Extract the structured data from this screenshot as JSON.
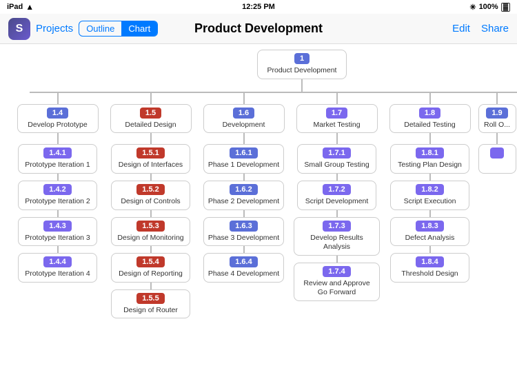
{
  "statusBar": {
    "left": "iPad",
    "time": "12:25 PM",
    "battery": "100%",
    "wifi": true
  },
  "navBar": {
    "projectsLabel": "Projects",
    "outlineLabel": "Outline",
    "chartLabel": "Chart",
    "title": "Product Development",
    "editLabel": "Edit",
    "shareLabel": "Share"
  },
  "root": {
    "id": "1",
    "label": "Product Development",
    "badgeColor": "blue"
  },
  "columns": [
    {
      "id": "1.4",
      "label": "Develop Prototype",
      "badgeColor": "blue",
      "children": [
        {
          "id": "1.4.1",
          "label": "Prototype Iteration 1",
          "badgeColor": "purple"
        },
        {
          "id": "1.4.2",
          "label": "Prototype Iteration 2",
          "badgeColor": "purple"
        },
        {
          "id": "1.4.3",
          "label": "Prototype Iteration 3",
          "badgeColor": "purple"
        },
        {
          "id": "1.4.4",
          "label": "Prototype Iteration 4",
          "badgeColor": "purple"
        }
      ]
    },
    {
      "id": "1.5",
      "label": "Detailed Design",
      "badgeColor": "red",
      "children": [
        {
          "id": "1.5.1",
          "label": "Design of Interfaces",
          "badgeColor": "red"
        },
        {
          "id": "1.5.2",
          "label": "Design of Controls",
          "badgeColor": "red"
        },
        {
          "id": "1.5.3",
          "label": "Design of Monitoring",
          "badgeColor": "red"
        },
        {
          "id": "1.5.4",
          "label": "Design of Reporting",
          "badgeColor": "red"
        },
        {
          "id": "1.5.5",
          "label": "Design of Router",
          "badgeColor": "red"
        }
      ]
    },
    {
      "id": "1.6",
      "label": "Development",
      "badgeColor": "blue",
      "children": [
        {
          "id": "1.6.1",
          "label": "Phase 1 Development",
          "badgeColor": "blue"
        },
        {
          "id": "1.6.2",
          "label": "Phase 2 Development",
          "badgeColor": "blue"
        },
        {
          "id": "1.6.3",
          "label": "Phase 3 Development",
          "badgeColor": "blue"
        },
        {
          "id": "1.6.4",
          "label": "Phase 4 Development",
          "badgeColor": "blue"
        }
      ]
    },
    {
      "id": "1.7",
      "label": "Market Testing",
      "badgeColor": "purple",
      "children": [
        {
          "id": "1.7.1",
          "label": "Small Group Testing",
          "badgeColor": "purple"
        },
        {
          "id": "1.7.2",
          "label": "Script Development",
          "badgeColor": "purple"
        },
        {
          "id": "1.7.3",
          "label": "Develop Results Analysis",
          "badgeColor": "purple"
        },
        {
          "id": "1.7.4",
          "label": "Review and Approve Go Forward",
          "badgeColor": "purple"
        }
      ]
    },
    {
      "id": "1.8",
      "label": "Detailed Testing",
      "badgeColor": "purple",
      "children": [
        {
          "id": "1.8.1",
          "label": "Testing Plan Design",
          "badgeColor": "purple"
        },
        {
          "id": "1.8.2",
          "label": "Script Execution",
          "badgeColor": "purple"
        },
        {
          "id": "1.8.3",
          "label": "Defect Analysis",
          "badgeColor": "purple"
        },
        {
          "id": "1.8.4",
          "label": "Threshold Design",
          "badgeColor": "purple"
        }
      ]
    },
    {
      "id": "1.9",
      "label": "Roll O...",
      "badgeColor": "blue",
      "children": []
    }
  ]
}
